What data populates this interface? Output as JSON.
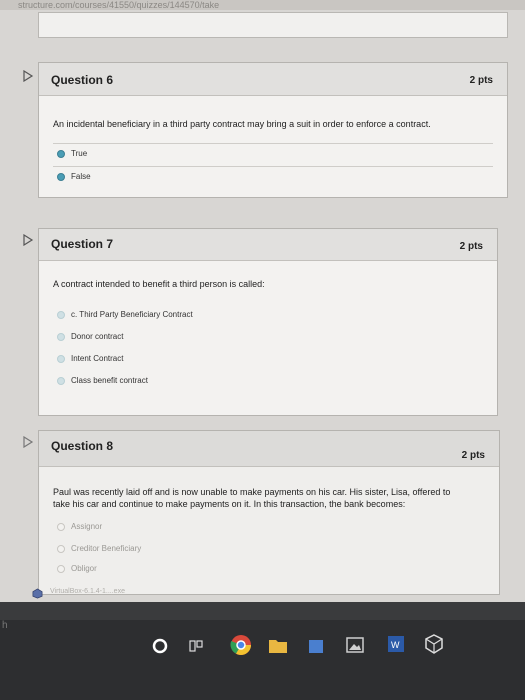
{
  "browser": {
    "url_fragment": "structure.com/courses/41550/quizzes/144570/take"
  },
  "questions": [
    {
      "title": "Question 6",
      "points": "2 pts",
      "text": "An incidental beneficiary in a third party contract may bring a suit in order to enforce a contract.",
      "answers": [
        {
          "label": "True"
        },
        {
          "label": "False"
        }
      ]
    },
    {
      "title": "Question 7",
      "points": "2 pts",
      "text": "A contract intended to benefit a third person is called:",
      "answers": [
        {
          "label": "c. Third Party Beneficiary Contract"
        },
        {
          "label": "Donor contract"
        },
        {
          "label": "Intent Contract"
        },
        {
          "label": "Class benefit contract"
        }
      ]
    },
    {
      "title": "Question 8",
      "points": "2 pts",
      "text_line1": "Paul was recently laid off and is now unable to make payments on his car. His sister, Lisa, offered to",
      "text_line2": "take his car and continue to make payments on it. In this transaction, the bank becomes:",
      "answers": [
        {
          "label": "Assignor"
        },
        {
          "label": "Creditor Beneficiary"
        },
        {
          "label": "Obligor"
        }
      ]
    }
  ],
  "download_bar": {
    "filename": "VirtualBox-6.1.4-1....exe"
  },
  "taskbar": {
    "search_hint": "h"
  }
}
